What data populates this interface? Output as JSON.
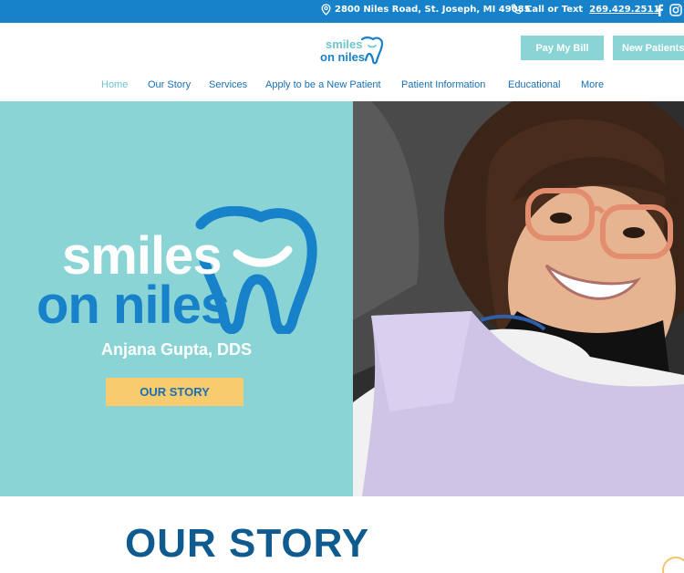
{
  "topbar": {
    "address": "2800 Niles Road, St. Joseph, MI 49085",
    "call_label": "Call or Text",
    "phone": "269.429.2511",
    "icons": [
      "map-pin-icon",
      "phone-icon",
      "facebook-icon",
      "instagram-icon"
    ]
  },
  "header": {
    "logo_line1": "smiles",
    "logo_line2": "on niles",
    "pay_bill": "Pay My Bill",
    "new_patients": "New Patients"
  },
  "nav": {
    "items": [
      "Home",
      "Our Story",
      "Services",
      "Apply to be a New Patient",
      "Patient Information",
      "Educational",
      "More"
    ],
    "active": "Home"
  },
  "hero": {
    "logo_line1": "smiles",
    "logo_line2": "on niles",
    "doctor": "Anjana Gupta, DDS",
    "cta": "OUR STORY"
  },
  "story": {
    "title": "OUR STORY"
  },
  "colors": {
    "topbar": "#1782c9",
    "teal": "#8ad4d6",
    "navy": "#0f5b8f",
    "gold": "#f8cb6f",
    "link_blue": "#1a6fb0"
  }
}
